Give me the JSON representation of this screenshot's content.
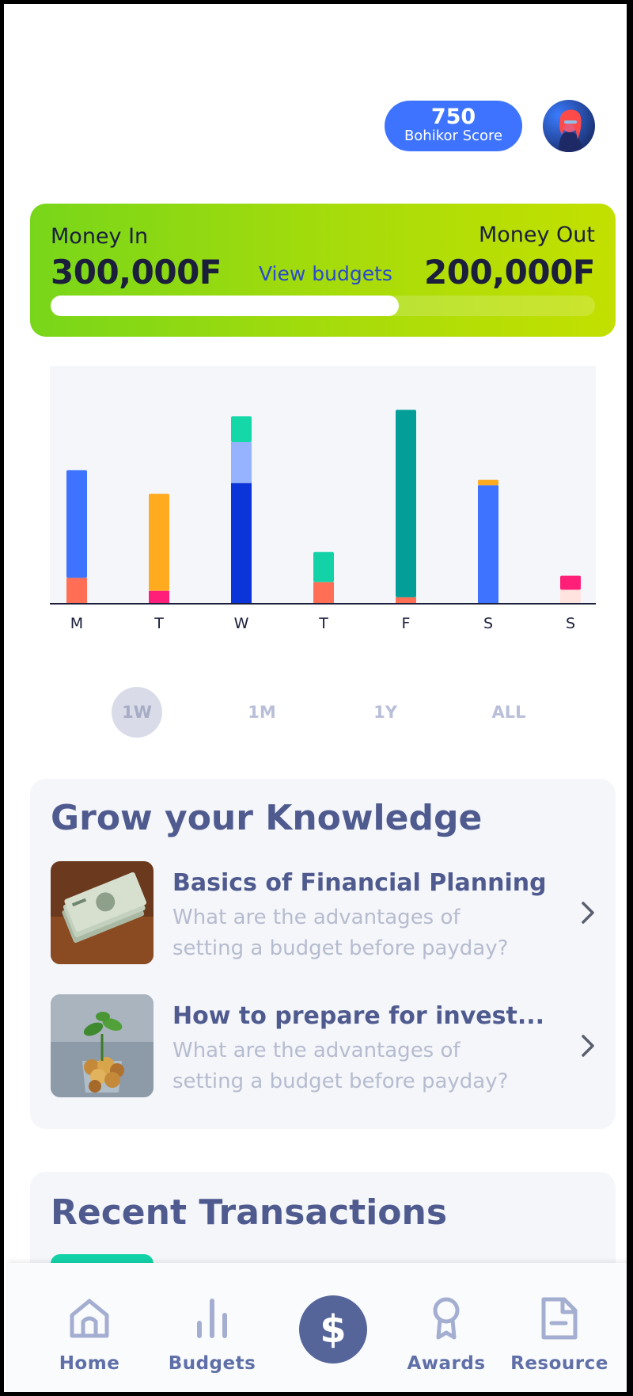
{
  "header": {
    "score_value": "750",
    "score_label": "Bohikor Score",
    "avatar_icon": "user-avatar-icon"
  },
  "money": {
    "in_label": "Money In",
    "in_value": "300,000F",
    "out_label": "Money Out",
    "out_value": "200,000F",
    "view_budgets": "View budgets",
    "progress_fraction": 0.64
  },
  "chart_data": {
    "type": "bar",
    "stacked": true,
    "categories": [
      "M",
      "T",
      "W",
      "T",
      "F",
      "S",
      "S"
    ],
    "ylim": [
      0,
      100
    ],
    "grid": false,
    "stacks": [
      [
        {
          "value": 12,
          "color": "#ff6e55"
        },
        {
          "value": 50,
          "color": "#3d73ff"
        }
      ],
      [
        {
          "value": 6,
          "color": "#ff1f78"
        },
        {
          "value": 45,
          "color": "#ffaa1f"
        }
      ],
      [
        {
          "value": 56,
          "color": "#0b35d8"
        },
        {
          "value": 19,
          "color": "#96b3ff"
        },
        {
          "value": 12,
          "color": "#14d8a8"
        }
      ],
      [
        {
          "value": 10,
          "color": "#ff6e55"
        },
        {
          "value": 14,
          "color": "#14d2a8"
        }
      ],
      [
        {
          "value": 3,
          "color": "#ff6e55"
        },
        {
          "value": 87,
          "color": "#049e98"
        }
      ],
      [
        {
          "value": 55,
          "color": "#3d73ff"
        },
        {
          "value": 2.5,
          "color": "#ffaa1f"
        }
      ],
      [
        {
          "value": 6.5,
          "color": "#ffe3df"
        },
        {
          "value": 6.5,
          "color": "#ff1f78"
        }
      ]
    ]
  },
  "periods": [
    {
      "label": "1W",
      "active": true
    },
    {
      "label": "1M",
      "active": false
    },
    {
      "label": "1Y",
      "active": false
    },
    {
      "label": "ALL",
      "active": false
    }
  ],
  "knowledge": {
    "title": "Grow your Knowledge",
    "articles": [
      {
        "title": "Basics of Financial Planning",
        "desc": "What are the advantages of setting a budget before payday?",
        "thumb": "money-stack-image"
      },
      {
        "title": "How to prepare for invest...",
        "desc": "What are the advantages of setting a budget before payday?",
        "thumb": "coin-plant-image"
      }
    ]
  },
  "transactions": {
    "title": "Recent Transactions"
  },
  "nav": {
    "items": [
      {
        "label": "Home",
        "icon": "home-icon"
      },
      {
        "label": "Budgets",
        "icon": "bar-chart-icon"
      },
      {
        "label": "",
        "icon": "dollar-icon",
        "center_symbol": "$"
      },
      {
        "label": "Awards",
        "icon": "award-icon"
      },
      {
        "label": "Resource",
        "icon": "document-icon"
      }
    ]
  },
  "colors": {
    "accent": "#3d73ff",
    "nav_text": "#5f6fa8",
    "heading": "#4f5b8f",
    "card_gradient_start": "#78d61a",
    "card_gradient_end": "#c3e000"
  }
}
